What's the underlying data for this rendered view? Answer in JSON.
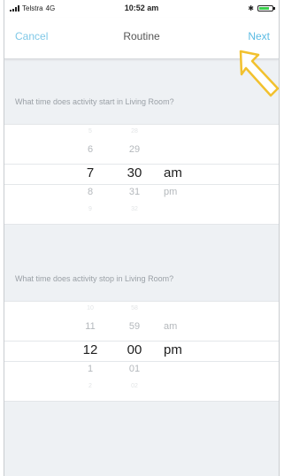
{
  "status_bar": {
    "carrier": "Telstra",
    "network": "4G",
    "time": "10:52 am",
    "bluetooth_icon": "bluetooth-icon",
    "battery_icon": "battery-icon"
  },
  "nav": {
    "cancel_label": "Cancel",
    "title": "Routine",
    "next_label": "Next"
  },
  "start": {
    "question": "What time does activity start in Living Room?",
    "hours": [
      "5",
      "6",
      "7",
      "8",
      "9"
    ],
    "minutes": [
      "28",
      "29",
      "30",
      "31",
      "32"
    ],
    "ampm": [
      "",
      "",
      "am",
      "pm",
      ""
    ],
    "selected": {
      "hour": "7",
      "minute": "30",
      "ampm": "am"
    }
  },
  "stop": {
    "question": "What time does activity stop in Living Room?",
    "hours": [
      "10",
      "11",
      "12",
      "1",
      "2"
    ],
    "minutes": [
      "58",
      "59",
      "00",
      "01",
      "02"
    ],
    "ampm": [
      "",
      "am",
      "pm",
      "",
      ""
    ],
    "selected": {
      "hour": "12",
      "minute": "00",
      "ampm": "pm"
    }
  },
  "colors": {
    "accent": "#5bbbe3",
    "annotation_arrow": "#f2c12e",
    "background": "#eef1f4"
  }
}
